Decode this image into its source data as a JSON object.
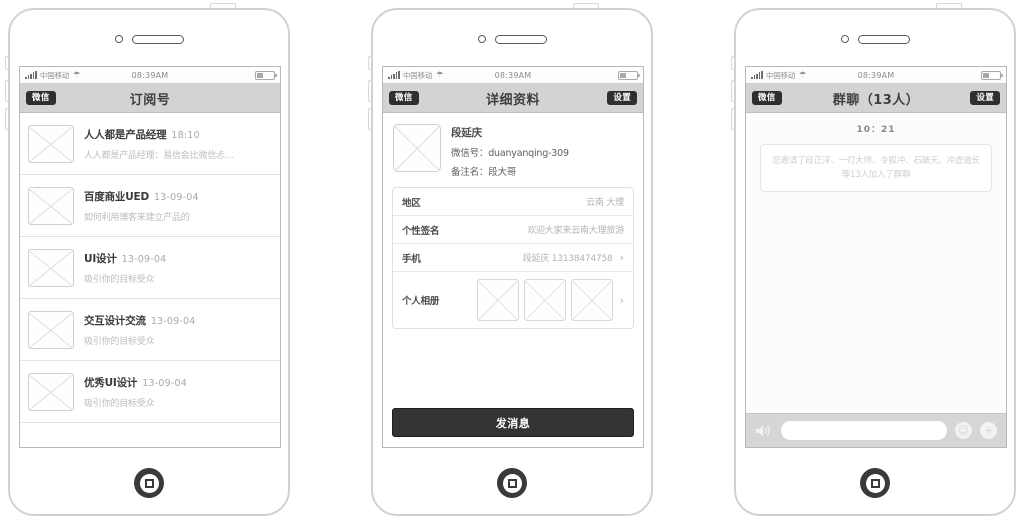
{
  "statusbar": {
    "carrier": "中国移动",
    "time": "08:39AM",
    "signal_icon": "signal-bars-icon",
    "wifi_icon": "wifi-icon",
    "battery_icon": "battery-icon"
  },
  "phone1": {
    "nav": {
      "back_label": "微信",
      "title": "订阅号"
    },
    "list": [
      {
        "title": "人人都是产品经理",
        "time": "18:10",
        "subtitle": "人人都是产品经理：易信会比微信忐…"
      },
      {
        "title": "百度商业UED",
        "time": "13-09-04",
        "subtitle": "如何利用博客来建立产品的"
      },
      {
        "title": "UI设计",
        "time": "13-09-04",
        "subtitle": "吸引你的目标受众"
      },
      {
        "title": "交互设计交流",
        "time": "13-09-04",
        "subtitle": "吸引你的目标受众"
      },
      {
        "title": "优秀UI设计",
        "time": "13-09-04",
        "subtitle": "吸引你的目标受众"
      }
    ]
  },
  "phone2": {
    "nav": {
      "back_label": "微信",
      "title": "详细资料",
      "settings_label": "设置"
    },
    "profile": {
      "name": "段延庆",
      "wechat_id": "微信号：duanyanqing-309",
      "remark_name": "备注名：段大哥"
    },
    "rows": [
      {
        "label": "地区",
        "value": "云南 大理",
        "chevron": ""
      },
      {
        "label": "个性签名",
        "value": "欢迎大家来云南大理旅游",
        "chevron": ""
      },
      {
        "label": "手机",
        "value": "段延庆 13138474758",
        "chevron": "›"
      }
    ],
    "album": {
      "label": "个人相册",
      "chevron": "›",
      "count": 3
    },
    "send_button": "发消息"
  },
  "phone3": {
    "nav": {
      "back_label": "微信",
      "title": "群聊（13人）",
      "settings_label": "设置"
    },
    "chat": {
      "timestamp": "10：21",
      "system_message": "您邀请了段正淳、一灯大师、令狐冲、石破天、冲虚道长等13人加入了群聊"
    },
    "toolbar": {
      "voice_icon": "speaker-icon",
      "input_placeholder": "",
      "emoji_icon": "smiley-icon",
      "plus_icon": "plus-icon"
    }
  },
  "colors": {
    "navbar": "#d3d3d3",
    "dark_button": "#2f2f2f",
    "send_button": "#333333",
    "frame": "#d2d2d2"
  }
}
